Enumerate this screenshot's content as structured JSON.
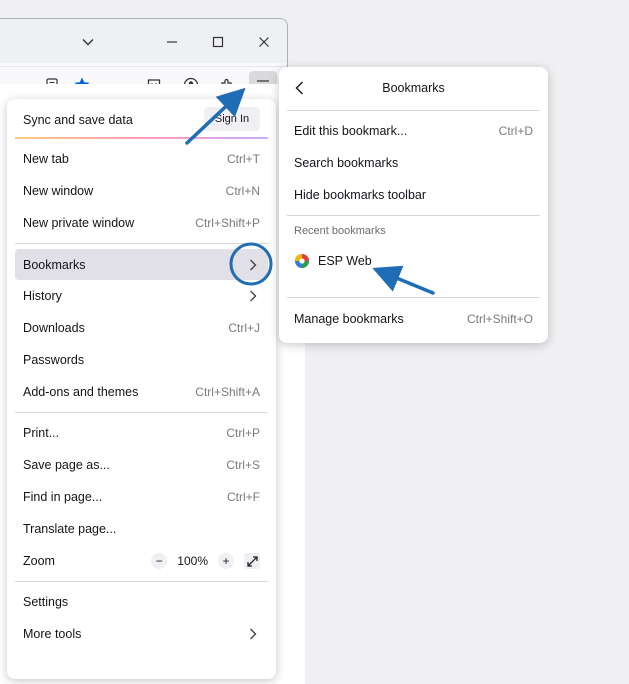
{
  "app_menu": {
    "sync": {
      "label": "Sync and save data",
      "button": "Sign In"
    },
    "items": [
      {
        "label": "New tab",
        "shortcut": "Ctrl+T"
      },
      {
        "label": "New window",
        "shortcut": "Ctrl+N"
      },
      {
        "label": "New private window",
        "shortcut": "Ctrl+Shift+P"
      },
      {
        "label": "Bookmarks",
        "shortcut": ""
      },
      {
        "label": "History",
        "shortcut": ""
      },
      {
        "label": "Downloads",
        "shortcut": "Ctrl+J"
      },
      {
        "label": "Passwords",
        "shortcut": ""
      },
      {
        "label": "Add-ons and themes",
        "shortcut": "Ctrl+Shift+A"
      },
      {
        "label": "Print...",
        "shortcut": "Ctrl+P"
      },
      {
        "label": "Save page as...",
        "shortcut": "Ctrl+S"
      },
      {
        "label": "Find in page...",
        "shortcut": "Ctrl+F"
      },
      {
        "label": "Translate page...",
        "shortcut": ""
      },
      {
        "label": "Zoom",
        "shortcut": ""
      },
      {
        "label": "Settings",
        "shortcut": ""
      },
      {
        "label": "More tools",
        "shortcut": ""
      }
    ],
    "zoom": {
      "minus": "−",
      "value": "100%",
      "plus": "+"
    }
  },
  "bookmarks_panel": {
    "title": "Bookmarks",
    "items": [
      {
        "label": "Edit this bookmark...",
        "shortcut": "Ctrl+D"
      },
      {
        "label": "Search bookmarks",
        "shortcut": ""
      },
      {
        "label": "Hide bookmarks toolbar",
        "shortcut": ""
      }
    ],
    "recent_heading": "Recent bookmarks",
    "recent": [
      {
        "label": "ESP Web",
        "icon": "esp-web-favicon"
      }
    ],
    "manage": {
      "label": "Manage bookmarks",
      "shortcut": "Ctrl+Shift+O"
    }
  },
  "toolbar_icons": [
    "reader-view-icon",
    "star-icon",
    "pocket-icon",
    "account-icon",
    "extensions-icon",
    "hamburger-menu-icon"
  ],
  "colors": {
    "accent": "#0060df",
    "annotation": "#1f6db5",
    "hover": "#e0e0e6",
    "star": "#0061e0"
  }
}
